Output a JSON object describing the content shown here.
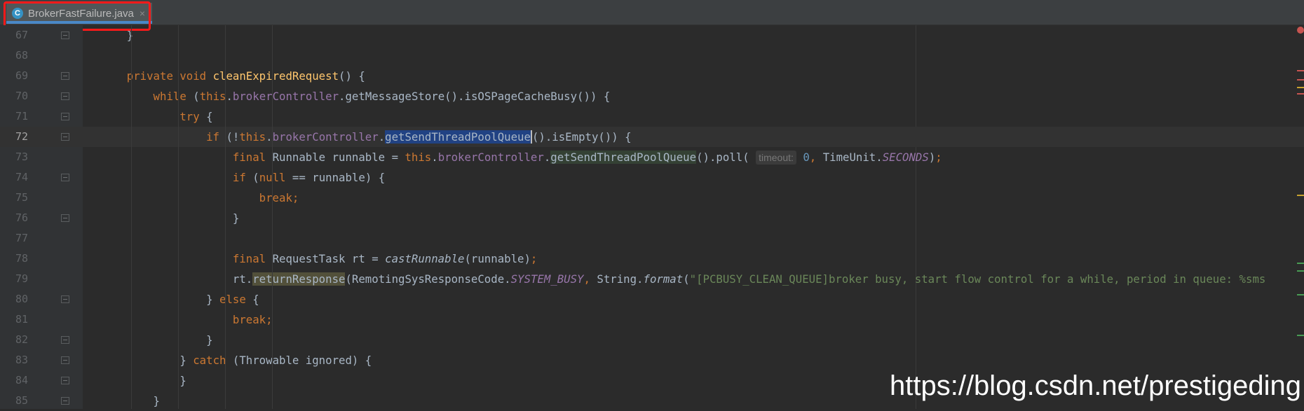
{
  "tab": {
    "filename": "BrokerFastFailure.java",
    "icon_letter": "C",
    "icon": "class-icon",
    "close": "×"
  },
  "lines": [
    {
      "num": "67",
      "parts": [
        [
          "p",
          "    }"
        ]
      ]
    },
    {
      "num": "68",
      "parts": []
    },
    {
      "num": "69",
      "parts": [
        [
          "kw",
          "    private void "
        ],
        [
          "fn",
          "cleanExpiredRequest"
        ],
        [
          "p",
          "() {"
        ]
      ]
    },
    {
      "num": "70",
      "parts": [
        [
          "kw",
          "        while "
        ],
        [
          "p",
          "("
        ],
        [
          "kw",
          "this"
        ],
        [
          "p",
          "."
        ],
        [
          "fld",
          "brokerController"
        ],
        [
          "p",
          ".getMessageStore().isOSPageCacheBusy()) {"
        ]
      ]
    },
    {
      "num": "71",
      "parts": [
        [
          "kw",
          "            try "
        ],
        [
          "p",
          "{"
        ]
      ]
    },
    {
      "num": "72",
      "parts": [
        [
          "kw",
          "                if "
        ],
        [
          "p",
          "(!"
        ],
        [
          "kw",
          "this"
        ],
        [
          "p",
          "."
        ],
        [
          "fld",
          "brokerController"
        ],
        [
          "p",
          "."
        ],
        [
          "sel",
          "getSendThreadPoolQueue"
        ],
        [
          "caret",
          "()"
        ],
        [
          "p",
          ".isEmpty()) {"
        ]
      ]
    },
    {
      "num": "73",
      "parts": [
        [
          "kw",
          "                    final "
        ],
        [
          "p",
          "Runnable runnable = "
        ],
        [
          "kw",
          "this"
        ],
        [
          "p",
          "."
        ],
        [
          "fld",
          "brokerController"
        ],
        [
          "p",
          "."
        ],
        [
          "hl",
          "getSendThreadPoolQueue"
        ],
        [
          "p",
          "().poll( "
        ],
        [
          "hint",
          "timeout:"
        ],
        [
          "num",
          " 0"
        ],
        [
          "kw",
          ", "
        ],
        [
          "p",
          "TimeUnit."
        ],
        [
          "st",
          "SECONDS"
        ],
        [
          "p",
          ")"
        ],
        [
          "kw",
          ";"
        ]
      ]
    },
    {
      "num": "74",
      "parts": [
        [
          "kw",
          "                    if "
        ],
        [
          "p",
          "("
        ],
        [
          "kw",
          "null "
        ],
        [
          "p",
          "== runnable) {"
        ]
      ]
    },
    {
      "num": "75",
      "parts": [
        [
          "kw",
          "                        break;"
        ]
      ]
    },
    {
      "num": "76",
      "parts": [
        [
          "p",
          "                    }"
        ]
      ]
    },
    {
      "num": "77",
      "parts": []
    },
    {
      "num": "78",
      "parts": [
        [
          "kw",
          "                    final "
        ],
        [
          "p",
          "RequestTask rt = "
        ],
        [
          "it",
          "castRunnable"
        ],
        [
          "p",
          "(runnable)"
        ],
        [
          "kw",
          ";"
        ]
      ]
    },
    {
      "num": "79",
      "parts": [
        [
          "p",
          "                    rt."
        ],
        [
          "hlr",
          "returnResponse"
        ],
        [
          "p",
          "(RemotingSysResponseCode."
        ],
        [
          "st",
          "SYSTEM_BUSY"
        ],
        [
          "kw",
          ", "
        ],
        [
          "p",
          "String."
        ],
        [
          "it",
          "format"
        ],
        [
          "p",
          "("
        ],
        [
          "str",
          "\"[PCBUSY_CLEAN_QUEUE]broker busy, start flow control for a while, period in queue: %sms"
        ]
      ]
    },
    {
      "num": "80",
      "parts": [
        [
          "p",
          "                } "
        ],
        [
          "kw",
          "else "
        ],
        [
          "p",
          "{"
        ]
      ]
    },
    {
      "num": "81",
      "parts": [
        [
          "kw",
          "                    break;"
        ]
      ]
    },
    {
      "num": "82",
      "parts": [
        [
          "p",
          "                }"
        ]
      ]
    },
    {
      "num": "83",
      "parts": [
        [
          "p",
          "            } "
        ],
        [
          "kw",
          "catch "
        ],
        [
          "p",
          "(Throwable ignored) {"
        ]
      ]
    },
    {
      "num": "84",
      "parts": [
        [
          "p",
          "            }"
        ]
      ]
    },
    {
      "num": "85",
      "parts": [
        [
          "p",
          "        }"
        ]
      ]
    }
  ],
  "watermark": "https://blog.csdn.net/prestigeding",
  "colors": {
    "background": "#2b2b2b",
    "keyword": "#cc7832",
    "field": "#9876aa",
    "method": "#ffc66d",
    "selection": "#214283",
    "tab_underline": "#4a88c7",
    "annotation_box": "#ff1a1a"
  }
}
